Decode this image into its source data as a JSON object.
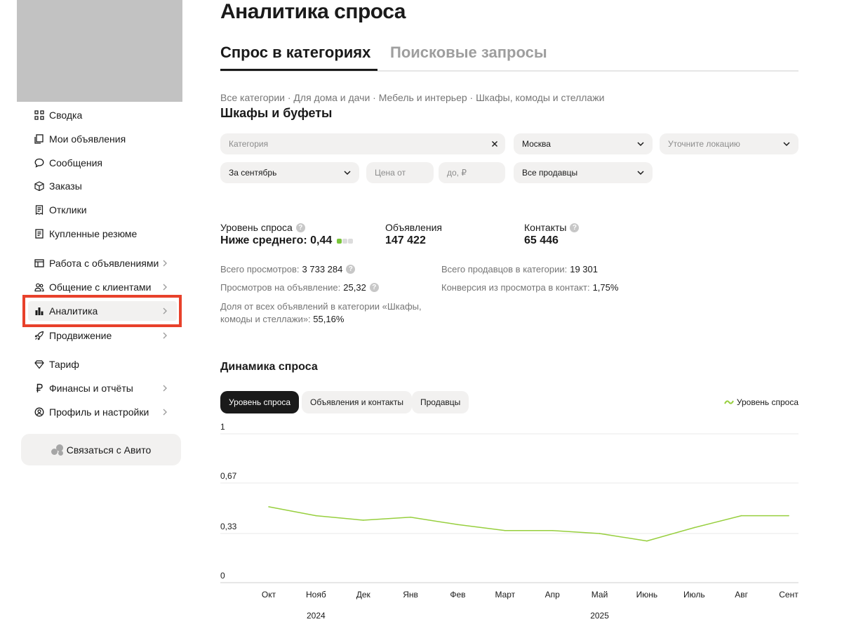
{
  "sidebar": {
    "items": [
      {
        "label": "Сводка",
        "icon": "grid-icon",
        "chevron": false
      },
      {
        "label": "Мои объявления",
        "icon": "copy-icon",
        "chevron": false
      },
      {
        "label": "Сообщения",
        "icon": "chat-bubble-icon",
        "chevron": false
      },
      {
        "label": "Заказы",
        "icon": "box-icon",
        "chevron": false
      },
      {
        "label": "Отклики",
        "icon": "document-list-icon",
        "chevron": false
      },
      {
        "label": "Купленные резюме",
        "icon": "resume-icon",
        "chevron": false
      },
      {
        "label": "Работа с объявлениями",
        "icon": "board-icon",
        "chevron": true
      },
      {
        "label": "Общение с клиентами",
        "icon": "people-icon",
        "chevron": true
      },
      {
        "label": "Аналитика",
        "icon": "bar-chart-icon",
        "chevron": true,
        "active": true
      },
      {
        "label": "Продвижение",
        "icon": "rocket-icon",
        "chevron": true
      },
      {
        "label": "Тариф",
        "icon": "diamond-icon",
        "chevron": false
      },
      {
        "label": "Финансы и отчёты",
        "icon": "ruble-icon",
        "chevron": true
      },
      {
        "label": "Профиль и настройки",
        "icon": "profile-icon",
        "chevron": true
      }
    ],
    "contact_button": "Связаться с Авито"
  },
  "header": {
    "title": "Аналитика спроса",
    "tabs": [
      {
        "label": "Спрос в категориях",
        "active": true
      },
      {
        "label": "Поисковые запросы",
        "active": false
      }
    ]
  },
  "breadcrumb": "Все категории · Для дома и дачи · Мебель и интерьер · Шкафы, комоды и стеллажи",
  "subtitle": "Шкафы и буфеты",
  "filters": {
    "category_placeholder": "Категория",
    "city": "Москва",
    "location_placeholder": "Уточните локацию",
    "period": "За сентябрь",
    "price_from_placeholder": "Цена от",
    "price_to_placeholder": "до, ₽",
    "sellers": "Все продавцы"
  },
  "stats": {
    "demand_label": "Уровень спроса",
    "demand_value": "Ниже среднего: 0,44",
    "demand_meter_level": 1,
    "demand_meter_max": 3,
    "ads_label": "Объявления",
    "ads_value": "147 422",
    "contacts_label": "Контакты",
    "contacts_value": "65 446"
  },
  "info": {
    "views_label": "Всего просмотров:",
    "views_value": "3 733 284",
    "views_per_ad_label": "Просмотров на объявление:",
    "views_per_ad_value": "25,32",
    "share_label": "Доля от всех объявлений в категории «Шкафы, комоды и стеллажи»:",
    "share_value": "55,16%",
    "sellers_label": "Всего продавцов в категории:",
    "sellers_value": "19 301",
    "conversion_label": "Конверсия из просмотра в контакт:",
    "conversion_value": "1,75%"
  },
  "dynamics": {
    "title": "Динамика спроса",
    "chips": [
      "Уровень спроса",
      "Объявления и контакты",
      "Продавцы"
    ],
    "legend": "Уровень спроса"
  },
  "colors": {
    "accent_green": "#97cf3e",
    "highlight_red": "#e8412b",
    "chip_dark": "#1a1a1a",
    "field_bg": "#f2f1f0"
  },
  "chart_data": {
    "type": "line",
    "categories": [
      "Окт",
      "Нояб",
      "Дек",
      "Янв",
      "Фев",
      "Март",
      "Апр",
      "Май",
      "Июнь",
      "Июль",
      "Авг",
      "Сент"
    ],
    "year_labels": [
      {
        "label": "2024",
        "category_index": 1
      },
      {
        "label": "2025",
        "category_index": 7
      }
    ],
    "y_ticks": [
      "0",
      "0,33",
      "0,67",
      "1"
    ],
    "ylim": [
      0,
      1
    ],
    "series": [
      {
        "name": "Уровень спроса",
        "values": [
          0.51,
          0.45,
          0.42,
          0.44,
          0.39,
          0.35,
          0.35,
          0.33,
          0.28,
          0.37,
          0.45,
          0.45
        ],
        "color": "#97cf3e"
      }
    ],
    "grid": true,
    "legend_position": "top-right"
  }
}
